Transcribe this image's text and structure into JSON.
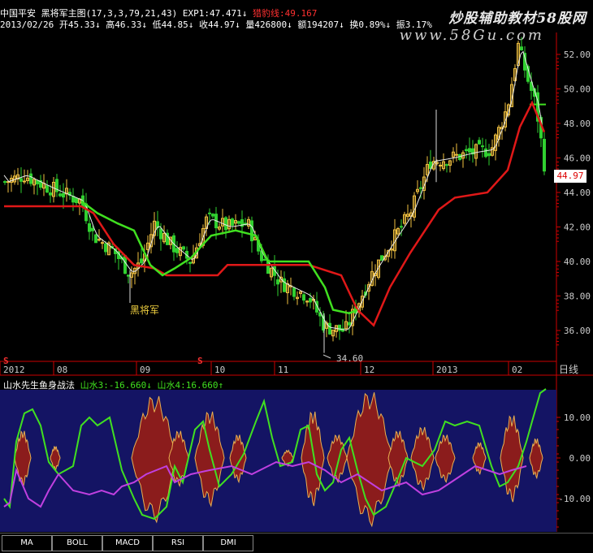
{
  "header": {
    "stock": "中国平安",
    "indicator": "黑将军主图(17,3,3,79,21,43)",
    "exp1_label": "EXP1:47.471",
    "exp_arrow": "↓",
    "exp2_label": "猎豹线:49.167",
    "date": "2013/02/26",
    "open": "开45.33",
    "high": "高46.33",
    "low": "低44.85",
    "close": "收44.97",
    "vol": "量426800",
    "amount": "额194207",
    "turnover": "换0.89%",
    "amplitude": "振3.17%"
  },
  "watermark": {
    "line1": "炒股辅助教材58股网",
    "line2": "www.58Gu.com"
  },
  "chart_annotations": {
    "heijiangjun": "黑将军",
    "low_label": "34.60"
  },
  "price_axis": [
    "52.00",
    "50.00",
    "48.00",
    "46.00",
    "44.00",
    "42.00",
    "40.00",
    "38.00",
    "36.00"
  ],
  "current_price": "44.97",
  "time_axis": [
    "2012",
    "08",
    "09",
    "10",
    "11",
    "12",
    "2013",
    "02"
  ],
  "time_axis_unit": "日线",
  "indicator_header": {
    "name": "山水先生鱼身战法",
    "v3": "山水3:-16.660",
    "v3_arrow": "↓",
    "v4": "山水4:16.660",
    "v4_arrow": "↑"
  },
  "ind_axis": [
    "10.00",
    "0.00",
    "-10.00"
  ],
  "tabs": [
    "MA",
    "BOLL",
    "MACD",
    "RSI",
    "DMI"
  ],
  "colors": {
    "up": "#f0c040",
    "down": "#30d030",
    "red_line": "#e01818",
    "green_line": "#40e020",
    "fish": "#8b1c1c",
    "fish_edge": "#e8b050",
    "purple": "#c040e0",
    "ind_bg": "#1a1a70"
  }
}
